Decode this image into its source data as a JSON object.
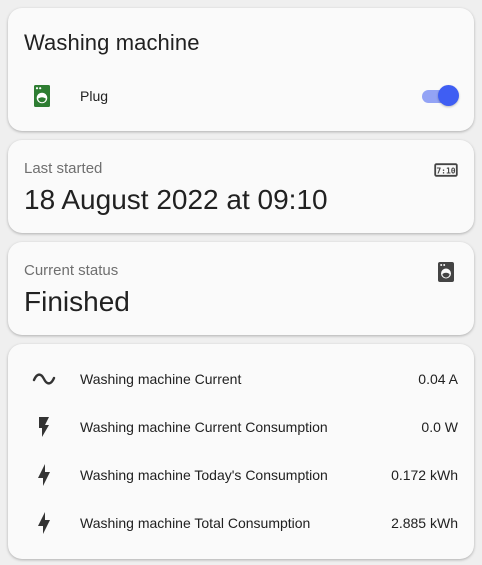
{
  "plug_card": {
    "title": "Washing machine",
    "row_label": "Plug",
    "toggle_on": true,
    "icon": "washing-machine-icon",
    "icon_color": "#2e7d32",
    "toggle_color": "#3f5ef3"
  },
  "last_started": {
    "label": "Last started",
    "value": "18 August 2022 at 09:10",
    "icon": "clock-digital-icon"
  },
  "current_status": {
    "label": "Current status",
    "value": "Finished",
    "icon": "washing-machine-icon"
  },
  "entities": [
    {
      "name": "Washing machine Current",
      "value": "0.04 A",
      "icon": "sine-wave-icon"
    },
    {
      "name": "Washing machine Current Consumption",
      "value": "0.0 W",
      "icon": "flash-icon"
    },
    {
      "name": "Washing machine Today's Consumption",
      "value": "0.172 kWh",
      "icon": "lightning-bolt-icon"
    },
    {
      "name": "Washing machine Total Consumption",
      "value": "2.885 kWh",
      "icon": "lightning-bolt-icon"
    }
  ]
}
